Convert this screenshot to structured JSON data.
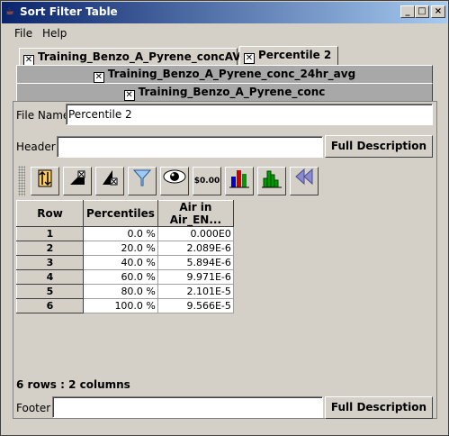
{
  "window": {
    "title": "Sort Filter Table"
  },
  "menu": {
    "file": "File",
    "help": "Help"
  },
  "tabs": {
    "row1": [
      {
        "label": "Training_Benzo_A_Pyrene_concAVG"
      },
      {
        "label": "Percentile 2"
      }
    ],
    "row2": {
      "label": "Training_Benzo_A_Pyrene_conc_24hr_avg"
    },
    "row3": {
      "label": "Training_Benzo_A_Pyrene_conc"
    }
  },
  "form": {
    "file_name_label": "File Name",
    "file_name_value": "Percentile 2",
    "header_label": "Header",
    "header_value": "",
    "header_button": "Full Description",
    "footer_label": "Footer",
    "footer_value": "",
    "footer_button": "Full Description"
  },
  "toolbar": {
    "icons": [
      "sort-vertical-icon",
      "filter-column-icon",
      "filter-row-icon",
      "funnel-icon",
      "eye-icon",
      "currency-format-icon",
      "bar-chart-icon",
      "histogram-icon",
      "rewind-icon"
    ],
    "currency_text": "$0.00"
  },
  "table": {
    "headers": [
      "Row",
      "Percentiles",
      "Air in Air_EN..."
    ],
    "rows": [
      [
        "1",
        "0.0 %",
        "0.000E0"
      ],
      [
        "2",
        "20.0 %",
        "2.089E-6"
      ],
      [
        "3",
        "40.0 %",
        "5.894E-6"
      ],
      [
        "4",
        "60.0 %",
        "9.971E-6"
      ],
      [
        "5",
        "80.0 %",
        "2.101E-5"
      ],
      [
        "6",
        "100.0 %",
        "9.566E-5"
      ]
    ]
  },
  "status": "6 rows : 2 columns",
  "colors": {
    "title_start": "#0a246a",
    "title_end": "#a6caf0",
    "face": "#d4d0c8"
  }
}
